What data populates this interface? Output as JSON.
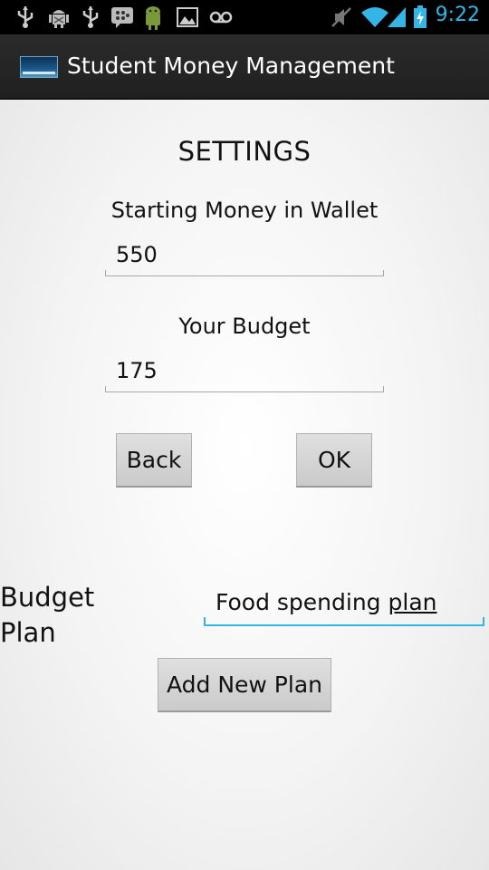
{
  "status_bar": {
    "time": "9:22",
    "icons": [
      "usb-icon",
      "android-debug-icon",
      "usb-icon",
      "bbm-icon",
      "android-icon",
      "image-icon",
      "voicemail-icon",
      "mute-icon",
      "wifi-icon",
      "signal-icon",
      "battery-charging-icon"
    ],
    "accent": "#33b5e5"
  },
  "action_bar": {
    "title": "Student Money Management"
  },
  "settings": {
    "heading": "SETTINGS",
    "wallet_label": "Starting Money in Wallet",
    "wallet_value": "550",
    "budget_label": "Your Budget",
    "budget_value": "175",
    "back_label": "Back",
    "ok_label": "OK"
  },
  "plan": {
    "label_line1": "Budget",
    "label_line2": "Plan",
    "value_prefix": "Food spending ",
    "value_word": "plan",
    "add_label": "Add New Plan"
  }
}
